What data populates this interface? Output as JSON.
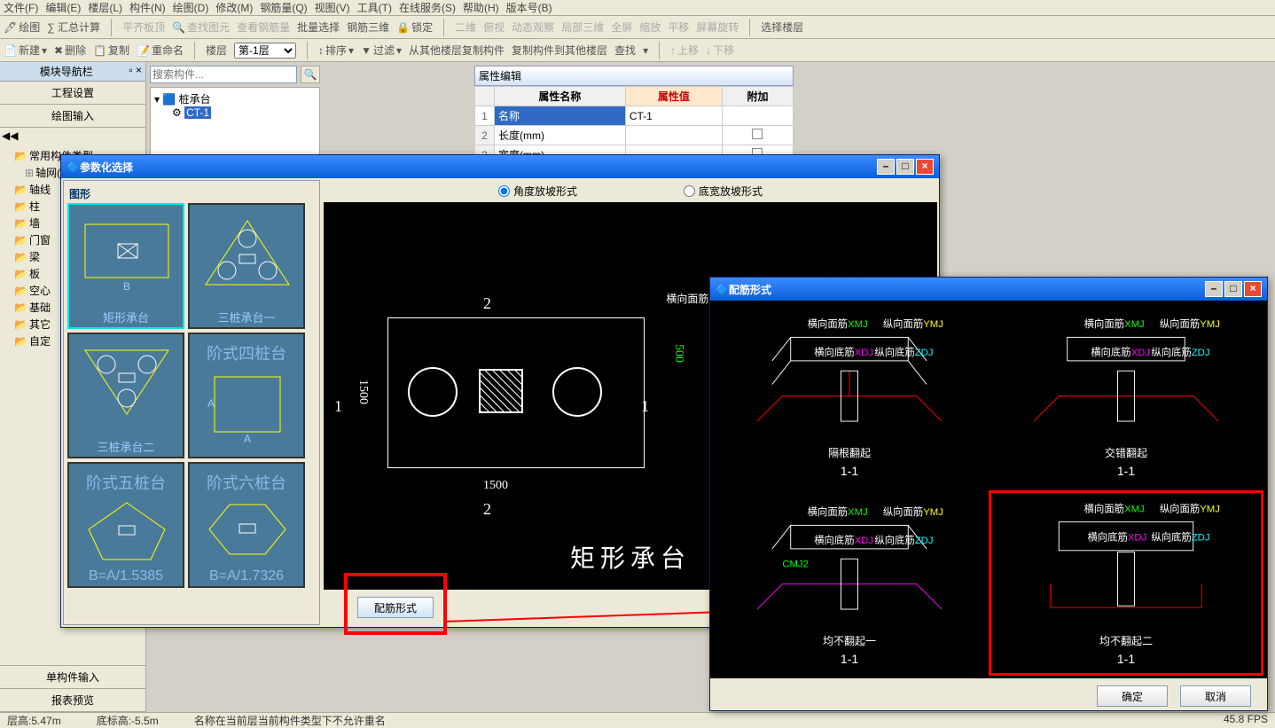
{
  "menu": [
    "文件(F)",
    "编辑(E)",
    "楼层(L)",
    "构件(N)",
    "绘图(D)",
    "修改(M)",
    "钢筋量(Q)",
    "视图(V)",
    "工具(T)",
    "在线服务(S)",
    "帮助(H)",
    "版本号(B)"
  ],
  "toolbar1": {
    "items": [
      "绘图",
      "∑ 汇总计算",
      "平齐板顶",
      "查找图元",
      "查看钢筋量",
      "批量选择",
      "钢筋三维",
      "锁定"
    ],
    "items2": [
      "二维",
      "俯视",
      "动态观察",
      "局部三维",
      "全屏",
      "缩放",
      "平移",
      "屏幕旋转",
      "选择楼层"
    ]
  },
  "toolbar2": {
    "new": "新建",
    "del": "删除",
    "copy": "复制",
    "rename": "重命名",
    "floor": "楼层",
    "floor_val": "第-1层",
    "sort": "排序",
    "filter": "过滤",
    "copy_from": "从其他楼层复制构件",
    "copy_to": "复制构件到其他楼层",
    "find": "查找",
    "up": "上移",
    "down": "下移"
  },
  "nav": {
    "title": "模块导航栏",
    "sections": [
      "工程设置",
      "绘图输入"
    ],
    "tree": [
      "常用构件类型",
      "轴网(J)",
      "轴线",
      "柱",
      "墙",
      "门窗",
      "梁",
      "板",
      "空心",
      "基础",
      "其它",
      "自定"
    ],
    "bottom": [
      "单构件输入",
      "报表预览"
    ]
  },
  "search_placeholder": "搜索构件...",
  "component_tree": {
    "root": "桩承台",
    "child": "CT-1"
  },
  "prop": {
    "title": "属性编辑",
    "headers": [
      "",
      "属性名称",
      "属性值",
      "附加"
    ],
    "rows": [
      {
        "n": "1",
        "name": "名称",
        "val": "CT-1",
        "cb": false
      },
      {
        "n": "2",
        "name": "长度(mm)",
        "val": "",
        "cb": true
      },
      {
        "n": "3",
        "name": "宽度(mm)",
        "val": "",
        "cb": true
      }
    ]
  },
  "status": {
    "left": "层高:5.47m",
    "mid": "底标高:-5.5m",
    "right": "名称在当前层当前构件类型下不允许重名",
    "fps": "45.8  FPS"
  },
  "modal1": {
    "title": "参数化选择",
    "graphics_label": "图形",
    "radio1": "角度放坡形式",
    "radio2": "底宽放坡形式",
    "shapes": [
      "矩形承台",
      "三桩承台一",
      "三桩承台二",
      "阶式四桩台",
      "阶式五桩台",
      "阶式六桩台"
    ],
    "sub5": "B=A/1.5385",
    "sub6": "B=A/1.7326",
    "preview_title": "矩形承台",
    "dim_w": "1500",
    "dim_h": "1500",
    "dim_h2": "500",
    "marks": {
      "one": "1",
      "two": "2"
    },
    "labels": {
      "h": "横向面筋",
      "hv": "XMJ",
      "v": "纵向面筋",
      "vv": "YMJ"
    },
    "button": "配筋形式"
  },
  "modal2": {
    "title": "配筋形式",
    "cards": [
      {
        "t": "隔根翻起",
        "s": "1-1"
      },
      {
        "t": "交错翻起",
        "s": "1-1"
      },
      {
        "t": "均不翻起一",
        "s": "1-1"
      },
      {
        "t": "均不翻起二",
        "s": "1-1"
      }
    ],
    "rebar_labels": {
      "hm": "横向面筋",
      "hmv": "XMJ",
      "zm": "纵向面筋",
      "zmv": "YMJ",
      "hd": "横向底筋",
      "hdv": "XDJ",
      "zd": "纵向底筋",
      "zdv": "ZDJ",
      "cmj": "CMJ2"
    },
    "ok": "确定",
    "cancel": "取消"
  }
}
